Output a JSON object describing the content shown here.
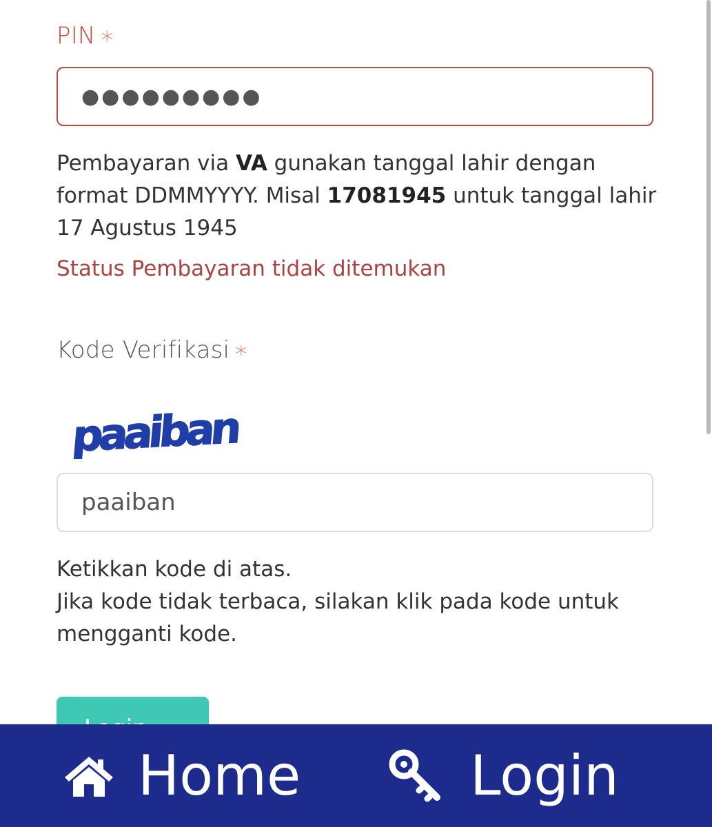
{
  "pin": {
    "label": "PIN",
    "required_marker": "∗",
    "value_masked": "●●●●●●●●●",
    "help_parts": [
      "Pembayaran via ",
      "VA",
      " gunakan tanggal lahir dengan format DDMMYYYY. Misal ",
      "17081945",
      " untuk tanggal lahir 17 Agustus 1945"
    ],
    "error": "Status Pembayaran tidak ditemukan"
  },
  "captcha": {
    "label": "Kode Verifikasi",
    "required_marker": "∗",
    "image_text": "paaiban",
    "input_value": "paaiban",
    "help_line1": "Ketikkan kode di atas.",
    "help_line2": "Jika kode tidak terbaca, silakan klik pada kode untuk mengganti kode."
  },
  "login_button": {
    "label": "Login"
  },
  "bottom_nav": {
    "home_label": "Home",
    "home_icon": "home-icon",
    "login_label": "Login",
    "login_icon": "key-icon"
  },
  "colors": {
    "error": "#a94442",
    "required": "#e8553d",
    "nav_bg": "#1d2b8c",
    "button": "#3fc9b5"
  }
}
